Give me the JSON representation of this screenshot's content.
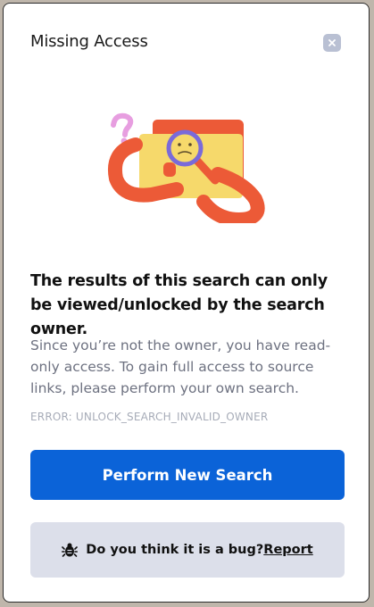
{
  "modal": {
    "title": "Missing Access",
    "close_icon": "close-icon",
    "illustration": "folder-magnifier-illustration",
    "headline": "The results of this search can only be viewed/unlocked by the search owner.",
    "description": "Since you’re not the owner, you have read-only access. To gain full access to source links, please perform your own search.",
    "error_code": "ERROR: UNLOCK_SEARCH_INVALID_OWNER",
    "primary_button": "Perform New Search",
    "bug_prompt": "Do you think it is a bug?",
    "bug_link": "Report",
    "bug_icon": "bug-icon"
  },
  "colors": {
    "primary": "#0b63d8",
    "bug_bar": "#dcdfea",
    "illustration_orange": "#ec5a37",
    "folder_yellow": "#f6d96b",
    "magnifier": "#7a6ad9"
  }
}
